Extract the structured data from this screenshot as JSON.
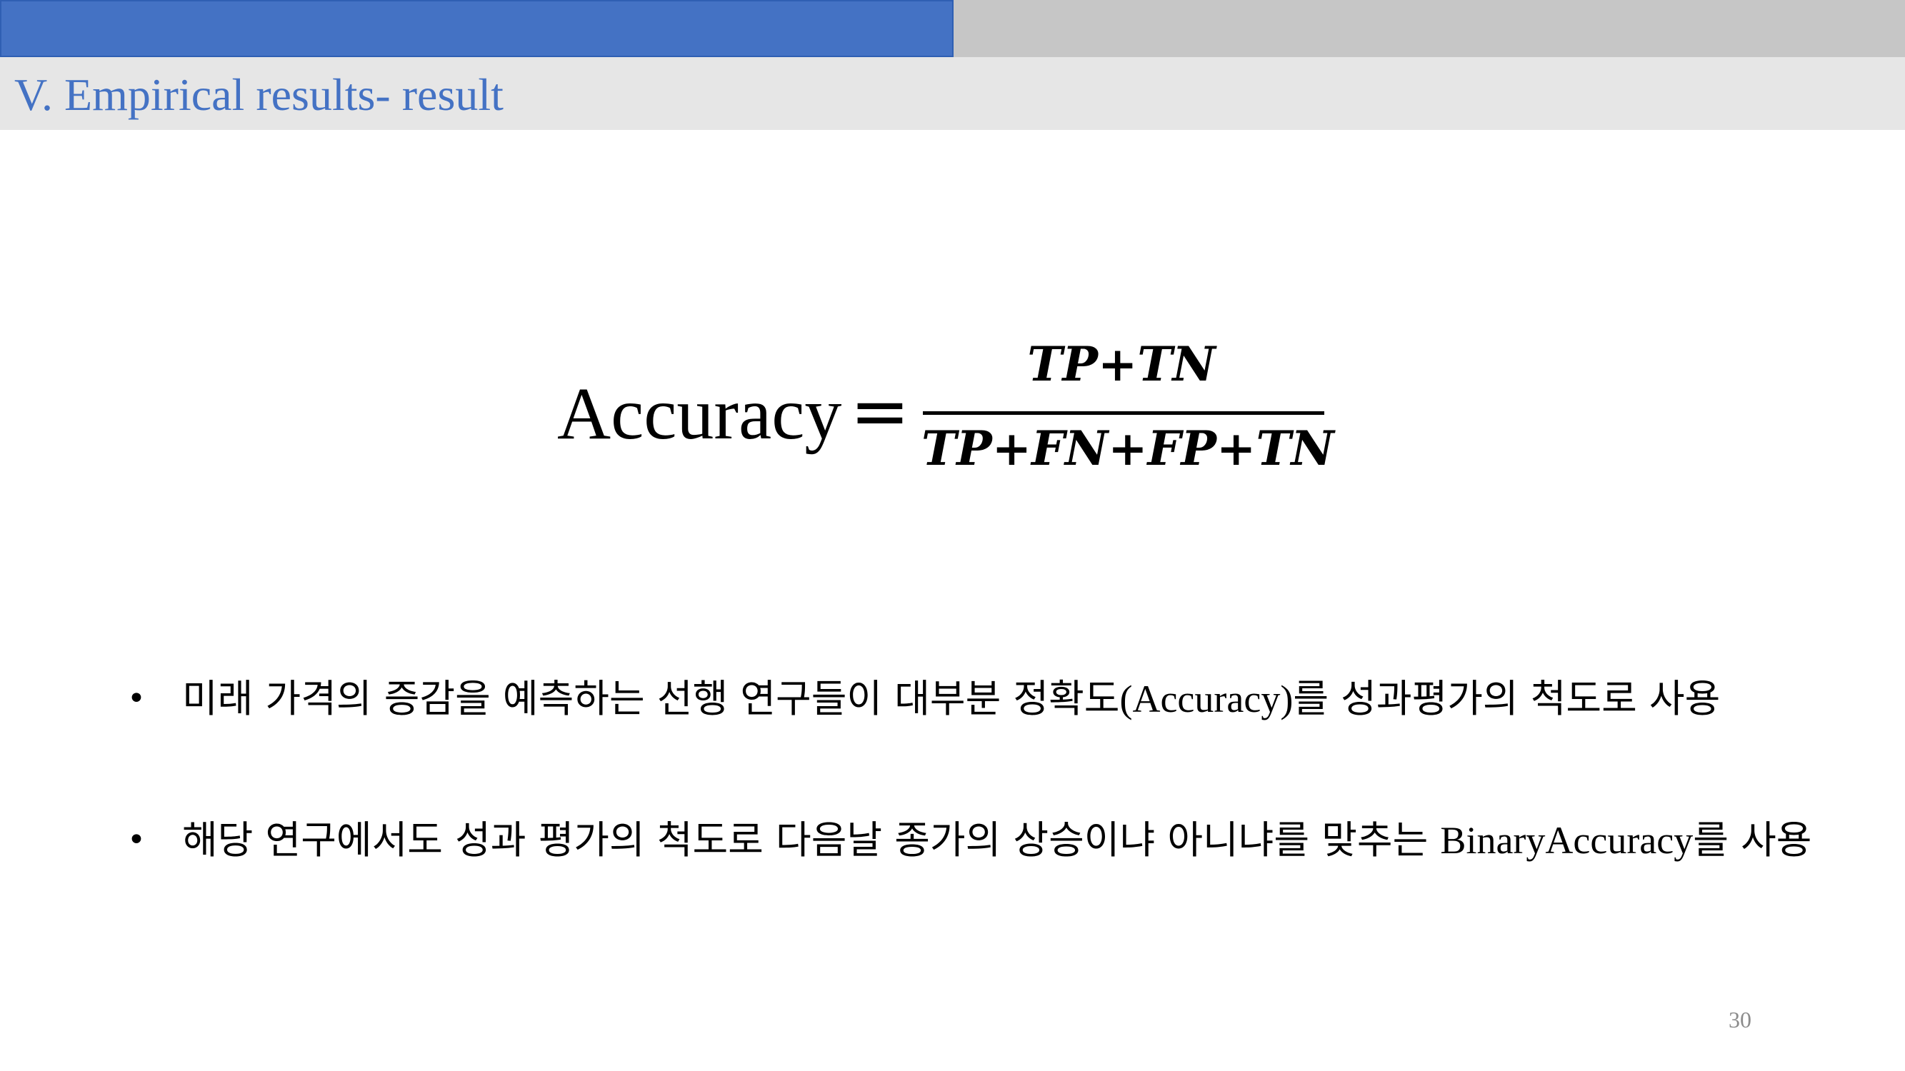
{
  "header": {
    "title": "V. Empirical results- result"
  },
  "formula": {
    "lhs": "Accuracy",
    "equals": "=",
    "numerator": "TP+TN",
    "denominator": "TP+FN+FP+TN"
  },
  "bullets": [
    {
      "marker": "•",
      "text_before": "미래 가격의 증감을 예측하는 선행 연구들이 대부분 정확도",
      "text_en": "(Accuracy)",
      "text_after": "를 성과평가의 척도로 사용"
    },
    {
      "marker": "•",
      "text_before": " 해당 연구에서도 성과 평가의 척도로 다음날 종가의 상승이냐 아니냐를 맞추는 ",
      "text_en": "BinaryAccuracy",
      "text_after": "를 사용"
    }
  ],
  "footer": {
    "page_number": "30"
  }
}
